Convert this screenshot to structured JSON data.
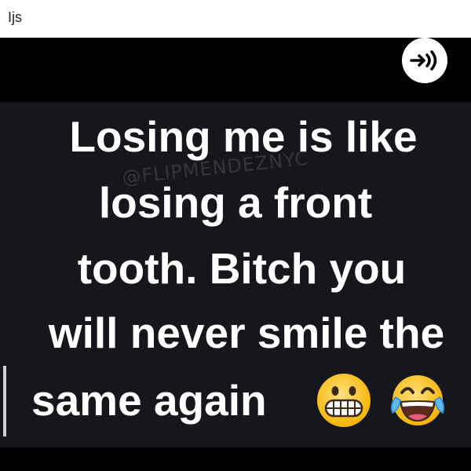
{
  "header": {
    "title": "Ijs"
  },
  "player": {
    "listen_icon": "podcast-listen-icon"
  },
  "meme": {
    "watermark": "@FLIPMENDEZNYC",
    "lines": [
      "Losing me is like",
      "losing a front",
      "tooth. Bitch you",
      "will never smile the",
      "same again"
    ],
    "emojis": [
      "grimacing-face-icon",
      "face-with-tears-of-joy-icon"
    ]
  },
  "colors": {
    "background": "#000000",
    "image_bg": "#16161d",
    "text": "#ffffff"
  }
}
